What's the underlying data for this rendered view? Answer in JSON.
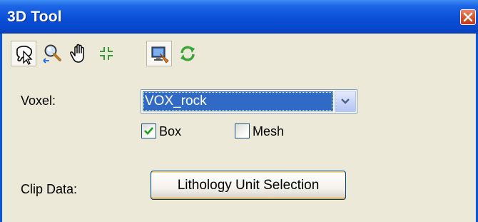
{
  "window": {
    "title": "3D Tool"
  },
  "toolbar": {
    "tools": [
      {
        "name": "select-tool",
        "icon": "lasso-pointer-icon",
        "pressed": true
      },
      {
        "name": "zoom-tool",
        "icon": "magnifier-arrows-icon",
        "pressed": false
      },
      {
        "name": "pan-tool",
        "icon": "hand-icon",
        "pressed": false
      },
      {
        "name": "full-extent-tool",
        "icon": "collapse-arrows-icon",
        "pressed": false
      },
      {
        "name": "display-tool",
        "icon": "monitor-icon",
        "pressed": true
      },
      {
        "name": "refresh-tool",
        "icon": "refresh-icon",
        "pressed": false
      }
    ]
  },
  "voxel": {
    "label": "Voxel:",
    "selected": "VOX_rock"
  },
  "options": {
    "box_label": "Box",
    "box_checked": true,
    "mesh_label": "Mesh",
    "mesh_checked": false
  },
  "clip": {
    "label": "Clip Data:",
    "button_label": "Lithology Unit Selection"
  },
  "colors": {
    "titlebar": "#0a4fd8",
    "selection": "#316ac5",
    "background": "#ece9d8",
    "close": "#d9532e"
  }
}
